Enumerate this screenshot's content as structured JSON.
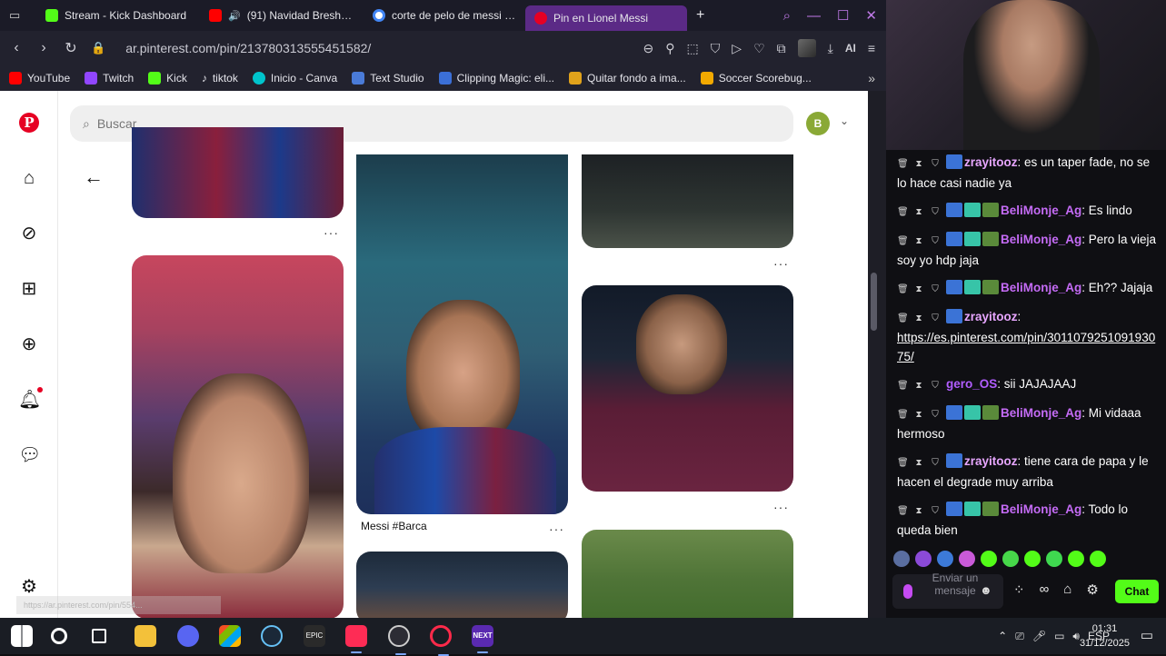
{
  "browser": {
    "tabs": [
      {
        "label": "Stream - Kick Dashboard",
        "icon": "kick-icon",
        "color": "#53fc18"
      },
      {
        "label": "(91) Navidad Bresh | D",
        "icon": "youtube-icon",
        "color": "#ff0000"
      },
      {
        "label": "corte de pelo de messi - B",
        "icon": "google-icon",
        "color": "#4285f4"
      },
      {
        "label": "Pin en Lionel Messi",
        "icon": "pinterest-icon",
        "color": "#e60023"
      }
    ],
    "new_tab": "+",
    "url": "ar.pinterest.com/pin/213780313555451582/",
    "ai_label": "AI",
    "bookmarks": [
      {
        "label": "YouTube",
        "color": "#ff0000"
      },
      {
        "label": "Twitch",
        "color": "#9146ff"
      },
      {
        "label": "Kick",
        "color": "#53fc18"
      },
      {
        "label": "tiktok",
        "color": "#ffffff"
      },
      {
        "label": "Inicio - Canva",
        "color": "#00c4cc"
      },
      {
        "label": "Text Studio",
        "color": "#4a7bd8"
      },
      {
        "label": "Clipping Magic: eli...",
        "color": "#3b6fd6"
      },
      {
        "label": "Quitar fondo a ima...",
        "color": "#e0a21b"
      },
      {
        "label": "Soccer Scorebug...",
        "color": "#f2a900"
      }
    ]
  },
  "pinterest": {
    "logo": "P",
    "search_placeholder": "Buscar",
    "avatar_initial": "B",
    "pin_title": "Messi #Barca",
    "more": "···",
    "status_url": "https://ar.pinterest.com/pin/554..."
  },
  "chat": {
    "messages": [
      {
        "user": "zrayitooz",
        "color": "#e7a6ff",
        "text": ": es un taper fade, no se lo hace casi nadie ya",
        "badges": 1
      },
      {
        "user": "BeliMonje_Ag",
        "color": "#c46bf5",
        "text": ": Es lindo",
        "badges": 3
      },
      {
        "user": "BeliMonje_Ag",
        "color": "#c46bf5",
        "text": ": Pero la vieja soy yo hdp jaja",
        "badges": 3
      },
      {
        "user": "BeliMonje_Ag",
        "color": "#c46bf5",
        "text": ": Eh?? Jajaja",
        "badges": 3
      },
      {
        "user": "zrayitooz",
        "color": "#e7a6ff",
        "text": ":",
        "badges": 1,
        "link": "https://es.pinterest.com/pin/301107925109193075/"
      },
      {
        "user": "gero_OS",
        "color": "#b15dff",
        "text": ": sii JAJAJAAJ",
        "badges": 0
      },
      {
        "user": "BeliMonje_Ag",
        "color": "#c46bf5",
        "text": ": Mi vidaaa hermoso",
        "badges": 3
      },
      {
        "user": "zrayitooz",
        "color": "#e7a6ff",
        "text": ": tiene cara de papa y le hacen el degrade muy arriba",
        "badges": 1
      },
      {
        "user": "BeliMonje_Ag",
        "color": "#c46bf5",
        "text": ": Todo lo queda bien",
        "badges": 3
      }
    ],
    "input_placeholder": "Enviar un mensaje",
    "send_label": "Chat"
  },
  "taskbar": {
    "language": "ESP",
    "time": "01:31",
    "date": "31/12/2025"
  }
}
